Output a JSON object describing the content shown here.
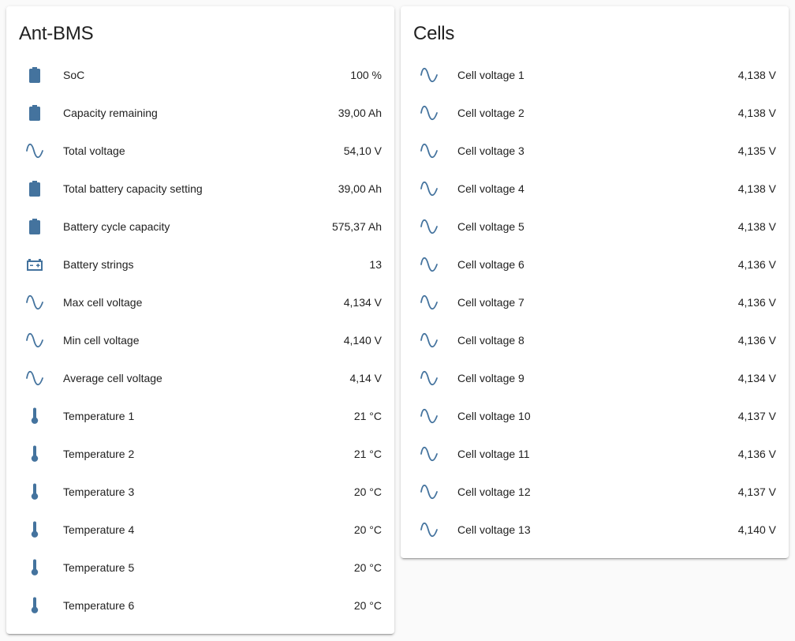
{
  "theme": {
    "accent": "#44739e",
    "text": "#212121",
    "card_bg": "#ffffff",
    "page_bg": "#fafafa"
  },
  "cards": [
    {
      "title": "Ant-BMS",
      "rows": [
        {
          "icon": "battery-icon",
          "label": "SoC",
          "value": "100 %"
        },
        {
          "icon": "battery-icon",
          "label": "Capacity remaining",
          "value": "39,00 Ah"
        },
        {
          "icon": "sine-wave-icon",
          "label": "Total voltage",
          "value": "54,10 V"
        },
        {
          "icon": "battery-icon",
          "label": "Total battery capacity setting",
          "value": "39,00 Ah"
        },
        {
          "icon": "battery-icon",
          "label": "Battery cycle capacity",
          "value": "575,37 Ah"
        },
        {
          "icon": "car-battery-icon",
          "label": "Battery strings",
          "value": "13"
        },
        {
          "icon": "sine-wave-icon",
          "label": "Max cell voltage",
          "value": "4,134 V"
        },
        {
          "icon": "sine-wave-icon",
          "label": "Min cell voltage",
          "value": "4,140 V"
        },
        {
          "icon": "sine-wave-icon",
          "label": "Average cell voltage",
          "value": "4,14 V"
        },
        {
          "icon": "thermometer-icon",
          "label": "Temperature 1",
          "value": "21 °C"
        },
        {
          "icon": "thermometer-icon",
          "label": "Temperature 2",
          "value": "21 °C"
        },
        {
          "icon": "thermometer-icon",
          "label": "Temperature 3",
          "value": "20 °C"
        },
        {
          "icon": "thermometer-icon",
          "label": "Temperature 4",
          "value": "20 °C"
        },
        {
          "icon": "thermometer-icon",
          "label": "Temperature 5",
          "value": "20 °C"
        },
        {
          "icon": "thermometer-icon",
          "label": "Temperature 6",
          "value": "20 °C"
        }
      ]
    },
    {
      "title": "Cells",
      "rows": [
        {
          "icon": "sine-wave-icon",
          "label": "Cell voltage 1",
          "value": "4,138 V"
        },
        {
          "icon": "sine-wave-icon",
          "label": "Cell voltage 2",
          "value": "4,138 V"
        },
        {
          "icon": "sine-wave-icon",
          "label": "Cell voltage 3",
          "value": "4,135 V"
        },
        {
          "icon": "sine-wave-icon",
          "label": "Cell voltage 4",
          "value": "4,138 V"
        },
        {
          "icon": "sine-wave-icon",
          "label": "Cell voltage 5",
          "value": "4,138 V"
        },
        {
          "icon": "sine-wave-icon",
          "label": "Cell voltage 6",
          "value": "4,136 V"
        },
        {
          "icon": "sine-wave-icon",
          "label": "Cell voltage 7",
          "value": "4,136 V"
        },
        {
          "icon": "sine-wave-icon",
          "label": "Cell voltage 8",
          "value": "4,136 V"
        },
        {
          "icon": "sine-wave-icon",
          "label": "Cell voltage 9",
          "value": "4,134 V"
        },
        {
          "icon": "sine-wave-icon",
          "label": "Cell voltage 10",
          "value": "4,137 V"
        },
        {
          "icon": "sine-wave-icon",
          "label": "Cell voltage 11",
          "value": "4,136 V"
        },
        {
          "icon": "sine-wave-icon",
          "label": "Cell voltage 12",
          "value": "4,137 V"
        },
        {
          "icon": "sine-wave-icon",
          "label": "Cell voltage 13",
          "value": "4,140 V"
        }
      ]
    }
  ]
}
